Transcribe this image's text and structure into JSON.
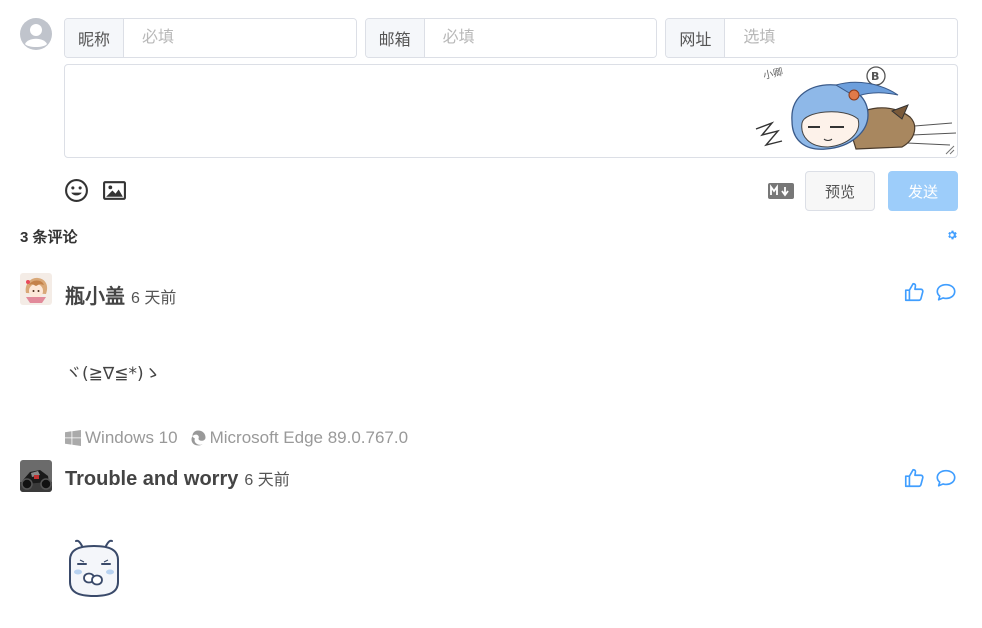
{
  "form": {
    "fields": [
      {
        "label": "昵称",
        "placeholder": "必填"
      },
      {
        "label": "邮箱",
        "placeholder": "必填"
      },
      {
        "label": "网址",
        "placeholder": "选填"
      }
    ],
    "mascot_signature": "小卿",
    "preview_label": "预览",
    "send_label": "发送",
    "icons": [
      "emoji-icon",
      "image-icon",
      "markdown-icon"
    ]
  },
  "comments_header": {
    "count_text": "3 条评论",
    "settings_icon": "gear-icon"
  },
  "comments": [
    {
      "nick": "瓶小盖",
      "time": "6 天前",
      "text": "ヾ(≧∇≦*)ゝ",
      "os": "Windows 10",
      "browser": "Microsoft Edge 89.0.767.0"
    },
    {
      "nick": "Trouble and worry",
      "time": "6 天前",
      "sticker": "shy-bunny-emoji"
    }
  ],
  "colors": {
    "accent": "#409eff",
    "send_button": "#9dcdfa",
    "border": "#dcdfe6",
    "label_bg": "#f5f7fa"
  }
}
